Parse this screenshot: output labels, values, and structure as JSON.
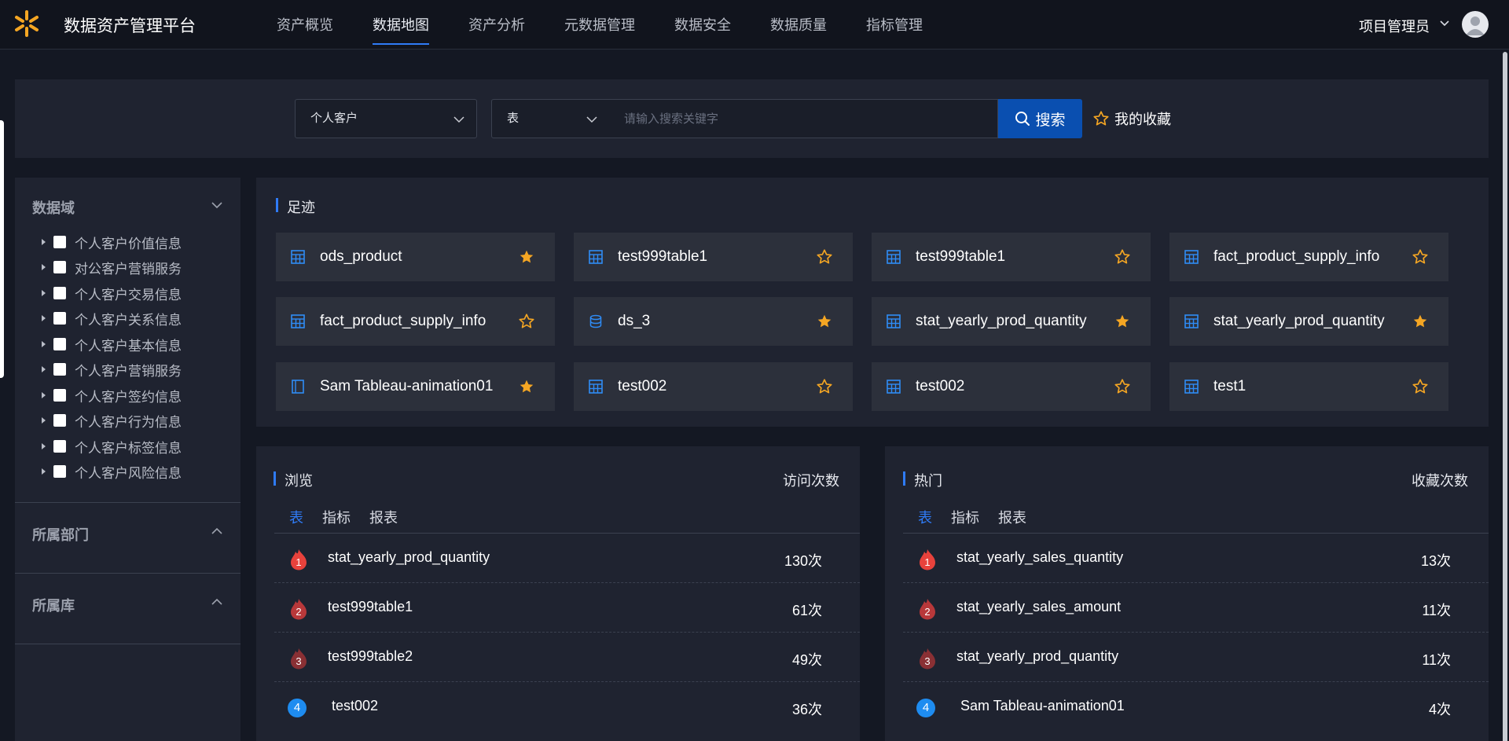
{
  "app": {
    "title": "数据资产管理平台",
    "user": "项目管理员"
  },
  "nav": {
    "items": [
      "资产概览",
      "数据地图",
      "资产分析",
      "元数据管理",
      "数据安全",
      "数据质量",
      "指标管理"
    ],
    "active": "数据地图"
  },
  "search": {
    "domain_select": "个人客户",
    "type_select": "表",
    "placeholder": "请输入搜索关键字",
    "value": "",
    "button": "搜索",
    "favorites": "我的收藏"
  },
  "filters": {
    "domain_title": "数据域",
    "domain_items": [
      "个人客户价值信息",
      "对公客户营销服务",
      "个人客户交易信息",
      "个人客户关系信息",
      "个人客户基本信息",
      "个人客户营销服务",
      "个人客户签约信息",
      "个人客户行为信息",
      "个人客户标签信息",
      "个人客户风险信息"
    ],
    "dept_title": "所属部门",
    "db_title": "所属库"
  },
  "footprint": {
    "title": "足迹",
    "cards": [
      {
        "name": "ods_product",
        "icon": "table-icon",
        "starred": true
      },
      {
        "name": "test999table1",
        "icon": "table-icon",
        "starred": false
      },
      {
        "name": "test999table1",
        "icon": "table-icon",
        "starred": false
      },
      {
        "name": "fact_product_supply_info",
        "icon": "table-icon",
        "starred": false
      },
      {
        "name": "fact_product_supply_info",
        "icon": "table-icon",
        "starred": false
      },
      {
        "name": "ds_3",
        "icon": "database-icon",
        "starred": true
      },
      {
        "name": "stat_yearly_prod_quantity",
        "icon": "table-icon",
        "starred": true
      },
      {
        "name": "stat_yearly_prod_quantity",
        "icon": "table-icon",
        "starred": true
      },
      {
        "name": "Sam Tableau-animation01",
        "icon": "report-icon",
        "starred": true
      },
      {
        "name": "test002",
        "icon": "table-icon",
        "starred": false
      },
      {
        "name": "test002",
        "icon": "table-icon",
        "starred": false
      },
      {
        "name": "test1",
        "icon": "table-icon",
        "starred": false
      }
    ]
  },
  "browse": {
    "title": "浏览",
    "metric": "访问次数",
    "tabs": [
      "表",
      "指标",
      "报表"
    ],
    "active_tab": "表",
    "rows": [
      {
        "rank": "1",
        "name": "stat_yearly_prod_quantity",
        "count": "130次"
      },
      {
        "rank": "2",
        "name": "test999table1",
        "count": "61次"
      },
      {
        "rank": "3",
        "name": "test999table2",
        "count": "49次"
      },
      {
        "rank": "4",
        "name": "test002",
        "count": "36次"
      }
    ]
  },
  "hot": {
    "title": "热门",
    "metric": "收藏次数",
    "tabs": [
      "表",
      "指标",
      "报表"
    ],
    "active_tab": "表",
    "rows": [
      {
        "rank": "1",
        "name": "stat_yearly_sales_quantity",
        "count": "13次"
      },
      {
        "rank": "2",
        "name": "stat_yearly_sales_amount",
        "count": "11次"
      },
      {
        "rank": "3",
        "name": "stat_yearly_prod_quantity",
        "count": "11次"
      },
      {
        "rank": "4",
        "name": "Sam Tableau-animation01",
        "count": "4次"
      }
    ]
  },
  "colors": {
    "accent": "#2f7bf6",
    "star": "#f5a623",
    "search_button": "#0a4fb0"
  }
}
